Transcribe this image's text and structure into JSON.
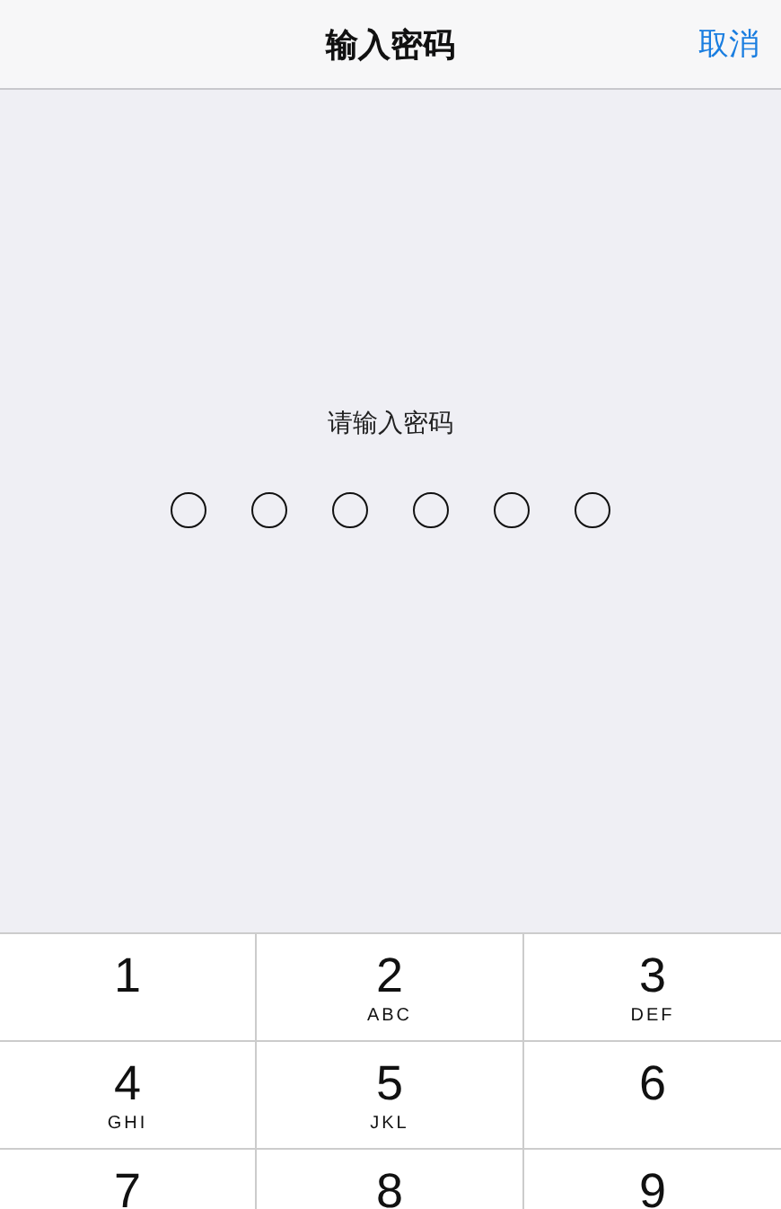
{
  "nav_bar": {
    "title": "输入密码",
    "cancel": "取消"
  },
  "prompt": "请输入密码",
  "passcode_dots": [
    {
      "filled": false
    },
    {
      "filled": false
    },
    {
      "filled": false
    },
    {
      "filled": false
    },
    {
      "filled": false
    },
    {
      "filled": false
    }
  ],
  "keypad": [
    {
      "digit": "1"
    },
    {
      "digit": "2",
      "letters": "ABC"
    },
    {
      "digit": "3",
      "letters": "DEF"
    },
    {
      "digit": "4",
      "letters": "GHI"
    },
    {
      "digit": "5",
      "letters": "JKL"
    },
    {
      "digit": "6"
    },
    {
      "digit": "7"
    },
    {
      "digit": "8"
    },
    {
      "digit": "9"
    }
  ]
}
